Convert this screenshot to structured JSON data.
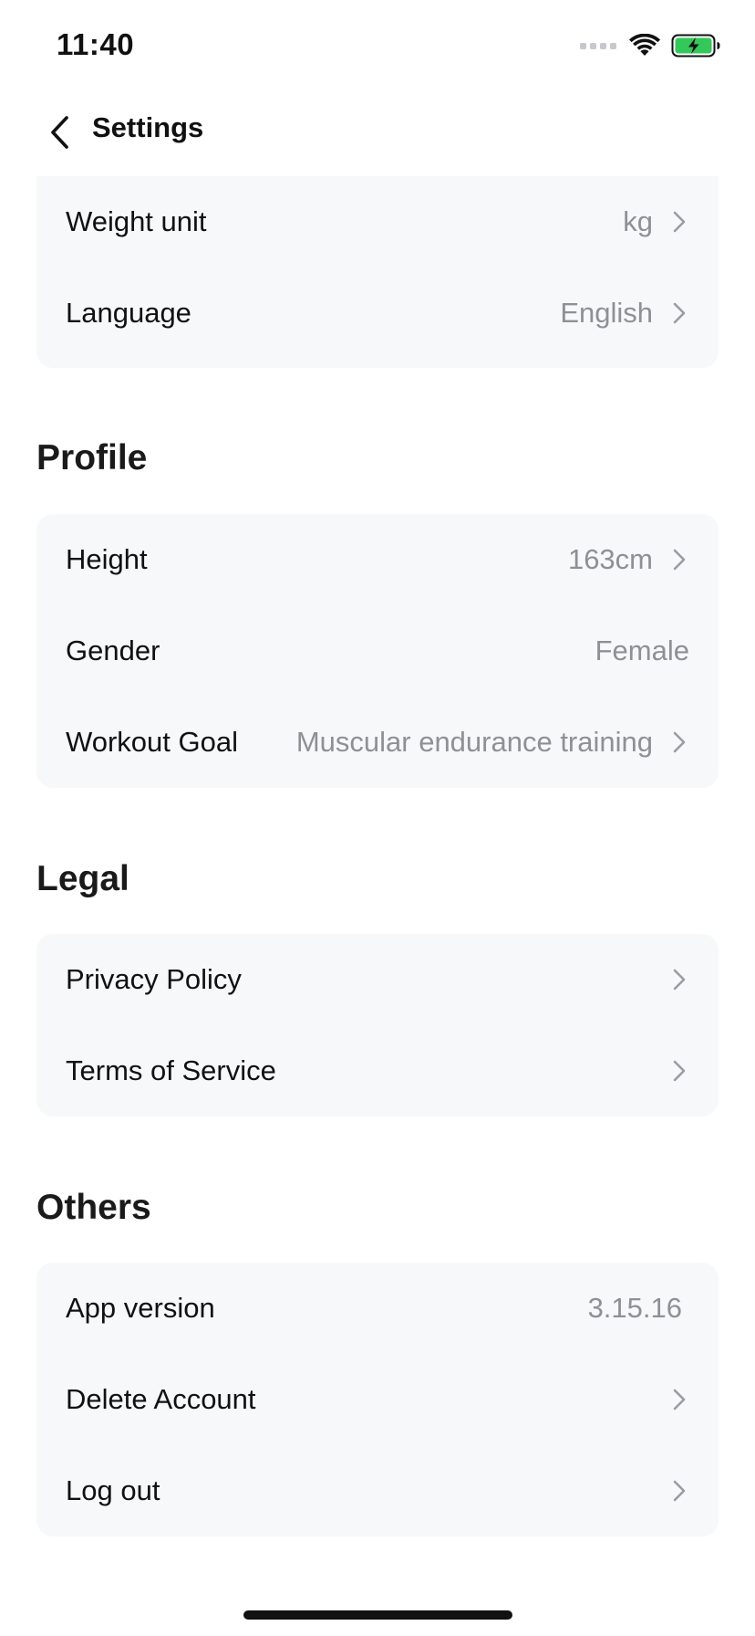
{
  "status_bar": {
    "time": "11:40",
    "icons": [
      "signal-icon",
      "wifi-icon",
      "battery-charging-icon"
    ],
    "battery_color": "#34c759"
  },
  "nav": {
    "back_icon": "chevron-left-icon",
    "title": "Settings"
  },
  "preferences": {
    "rows": [
      {
        "label": "Weight unit",
        "value": "kg"
      },
      {
        "label": "Language",
        "value": "English"
      }
    ]
  },
  "profile": {
    "title": "Profile",
    "rows": [
      {
        "label": "Height",
        "value": "163cm"
      },
      {
        "label": "Gender",
        "value": "Female"
      },
      {
        "label": "Workout Goal",
        "value": "Muscular endurance training"
      }
    ]
  },
  "legal": {
    "title": "Legal",
    "rows": [
      {
        "label": "Privacy Policy"
      },
      {
        "label": "Terms of Service"
      }
    ]
  },
  "others": {
    "title": "Others",
    "rows": [
      {
        "label": "App version",
        "value": "3.15.16"
      },
      {
        "label": "Delete Account"
      },
      {
        "label": "Log out"
      }
    ]
  },
  "colors": {
    "group_background": "#f7f8fa",
    "secondary_text": "#8e9094",
    "chevron": "#9a9ca0"
  }
}
